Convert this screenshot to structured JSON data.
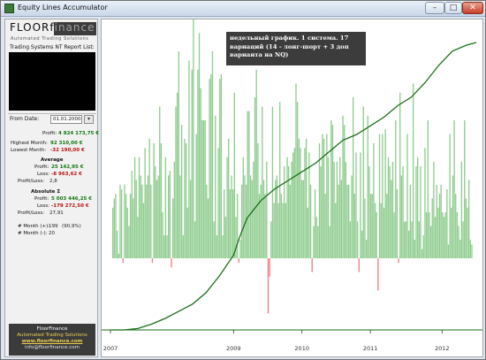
{
  "window": {
    "title": "Equity Lines Accumulator",
    "min_label": "–",
    "max_label": "□",
    "close_label": "✕"
  },
  "logo": {
    "brand": "FLOORfinance",
    "tagline": "Automated Trading Solutions"
  },
  "sidebar": {
    "report_list_label": "Trading Systems NT Report List:",
    "from_date_label": "From Date:",
    "from_date_value": "01.01.2000",
    "date_picker_icon": "calendar-dropdown-icon",
    "profit_label": "Profit:",
    "profit_value": "4 824 173,75 €",
    "highest_month_label": "Highest Month:",
    "highest_month_value": "92 310,00 €",
    "lowest_month_label": "Lowest Month:",
    "lowest_month_value": "-32 190,00 €",
    "average_header": "Average",
    "avg_profit_label": "Profit:",
    "avg_profit_value": "25 142,95 €",
    "avg_loss_label": "Loss:",
    "avg_loss_value": "-8 963,62 €",
    "avg_pl_label": "Profit/Loss:",
    "avg_pl_value": "2,8",
    "absolute_header": "Absolute Σ",
    "abs_profit_label": "Profit:",
    "abs_profit_value": "5 003 446,25 €",
    "abs_loss_label": "Loss:",
    "abs_loss_value": "-179 272,50 €",
    "abs_pl_label": "Profit/Loss:",
    "abs_pl_value": "27,91",
    "month_pos_label": "# Month (+):",
    "month_pos_value": "199",
    "month_pos_pct": "(90,9%)",
    "month_neg_label": "# Month (-):",
    "month_neg_value": "20"
  },
  "footer": {
    "company": "FloorFinance",
    "tagline": "Automated Trading Solutions",
    "website": "www.floorfinance.com",
    "email": "info@floorfinance.com"
  },
  "annotation": {
    "text": "недельный график. 1 система. 17 вариаций (14 - лонг-шорт + 3 доп варианта на NQ)"
  },
  "colors": {
    "bar_positive": "#8fcc8f",
    "bar_negative": "#f08080",
    "equity_line": "#1a6e1a",
    "baseline": "#1a6e1a"
  },
  "chart_data": {
    "type": "bar",
    "x_ticks": [
      "2007",
      "2009",
      "2010",
      "2011",
      "2012"
    ],
    "x_range": [
      2007.0,
      2012.35
    ],
    "bar_values": [
      11,
      13,
      14,
      6,
      1,
      16,
      15,
      -1,
      16,
      14,
      11,
      7,
      14,
      19,
      13,
      22,
      17,
      9,
      22,
      18,
      16,
      12,
      24,
      16,
      18,
      26,
      16,
      -1,
      25,
      20,
      17,
      18,
      33,
      25,
      10,
      5,
      22,
      5,
      18,
      19,
      -2,
      13,
      21,
      33,
      36,
      45,
      18,
      29,
      5,
      26,
      25,
      11,
      43,
      17,
      41,
      52,
      8,
      27,
      41,
      49,
      37,
      30,
      30,
      30,
      16,
      13,
      39,
      40,
      45,
      8,
      31,
      5,
      24,
      39,
      40,
      5,
      15,
      9,
      22,
      26,
      15,
      18,
      15,
      36,
      9,
      14,
      -1,
      4,
      16,
      22,
      18,
      16,
      32,
      32,
      18,
      17,
      21,
      35,
      41,
      25,
      14,
      16,
      33,
      17,
      14,
      21,
      -12,
      -4,
      8,
      33,
      12,
      17,
      18,
      12,
      34,
      14,
      12,
      20,
      12,
      22,
      20,
      16,
      21,
      23,
      24,
      38,
      34,
      26,
      24,
      17,
      17,
      24,
      26,
      11,
      23,
      16,
      -3,
      7,
      15,
      9,
      7,
      25,
      20,
      27,
      26,
      14,
      27,
      22,
      7,
      30,
      29,
      21,
      12,
      21,
      16,
      22,
      17,
      31,
      29,
      21,
      16,
      16,
      8,
      18,
      35,
      14,
      23,
      8,
      -3,
      23,
      6,
      33,
      13,
      4,
      31,
      20,
      14,
      14,
      25,
      12,
      10,
      -7,
      27,
      12,
      27,
      11,
      28,
      14,
      22,
      20,
      17,
      21,
      10,
      30,
      15,
      -1,
      36,
      18,
      20,
      8,
      8,
      27,
      6,
      16,
      8,
      38,
      4,
      20,
      22,
      8,
      20,
      2,
      5,
      24,
      10,
      30,
      10,
      7,
      13,
      21,
      9,
      16,
      11,
      14,
      16,
      10,
      9,
      10,
      15,
      3,
      27,
      11,
      18,
      30,
      14,
      10,
      7,
      4,
      21,
      8,
      30,
      13,
      11,
      17,
      4,
      3
    ],
    "equity_line": [
      [
        2007.0,
        0
      ],
      [
        2007.2,
        0
      ],
      [
        2007.4,
        0.5
      ],
      [
        2007.6,
        2
      ],
      [
        2007.8,
        4
      ],
      [
        2008.0,
        6.5
      ],
      [
        2008.2,
        9
      ],
      [
        2008.4,
        13
      ],
      [
        2008.6,
        19
      ],
      [
        2008.8,
        26
      ],
      [
        2008.9,
        33
      ],
      [
        2009.0,
        39
      ],
      [
        2009.2,
        45
      ],
      [
        2009.4,
        49
      ],
      [
        2009.6,
        52
      ],
      [
        2009.8,
        55
      ],
      [
        2010.0,
        58
      ],
      [
        2010.2,
        62
      ],
      [
        2010.4,
        66
      ],
      [
        2010.6,
        68
      ],
      [
        2010.8,
        71
      ],
      [
        2011.0,
        74
      ],
      [
        2011.2,
        78
      ],
      [
        2011.4,
        81
      ],
      [
        2011.6,
        86
      ],
      [
        2011.8,
        92
      ],
      [
        2012.0,
        97
      ],
      [
        2012.2,
        99
      ],
      [
        2012.35,
        100
      ]
    ],
    "title": "",
    "xlabel": "",
    "ylabel": "",
    "grid": false
  }
}
